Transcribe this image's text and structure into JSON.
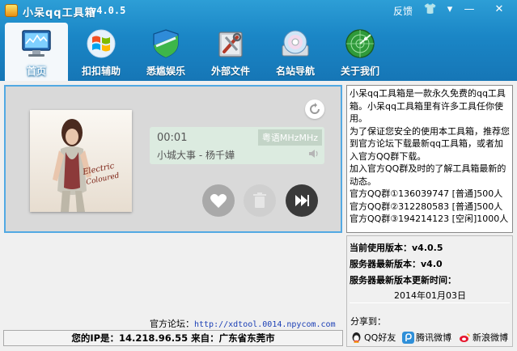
{
  "window": {
    "title": "小呆qq工具箱",
    "version": "v4.0.5",
    "feedback_label": "反馈",
    "controls": [
      "👕",
      "▾",
      "—",
      "✕"
    ]
  },
  "nav": [
    {
      "label": "首页",
      "icon": "monitor-chart-icon",
      "active": true
    },
    {
      "label": "扣扣辅助",
      "icon": "windows-logo-icon",
      "active": false
    },
    {
      "label": "悉尴娱乐",
      "icon": "shield-icon",
      "active": false
    },
    {
      "label": "外部文件",
      "icon": "tools-box-icon",
      "active": false
    },
    {
      "label": "名站导航",
      "icon": "disc-icon",
      "active": false
    },
    {
      "label": "关于我们",
      "icon": "radar-icon",
      "active": false
    }
  ],
  "player": {
    "time": "00:01",
    "channel": "粤语MHzMHz",
    "song": "小城大事 - 杨千嬅",
    "album_text": "Electric Coloured"
  },
  "intro": {
    "lines": [
      "小呆qq工具箱是一款永久免费的qq工具箱。小呆qq工具箱里有许多工具任你使用。",
      "为了保证您安全的使用本工具箱，推荐您到官方论坛下载最新qq工具箱，或者加入官方QQ群下载。",
      "加入官方QQ群及时的了解工具箱最新的动态。",
      "官方QQ群①136039747 [普通]500人",
      "官方QQ群②312280583 [普通]500人",
      "官方QQ群③194214123 [空闲]1000人"
    ]
  },
  "version_panel": {
    "current": "当前使用版本：v4.0.5",
    "server": "服务器最新版本：v4.0",
    "updated_label": "服务器最新版本更新时间：",
    "updated_date": "2014年01月03日",
    "share_label": "分享到：",
    "shares": [
      "QQ好友",
      "腾讯微博",
      "新浪微博"
    ]
  },
  "footer": {
    "forum_label": "官方论坛：",
    "forum_url": "http://xdtool.0014.npycom.com",
    "ip_text": "您的IP是：14.218.96.55 来自：广东省东莞市"
  },
  "colors": {
    "toolbar_blue": "#1a86c6",
    "frame_blue": "#52a9e3",
    "link_blue": "#1b3fb5"
  }
}
